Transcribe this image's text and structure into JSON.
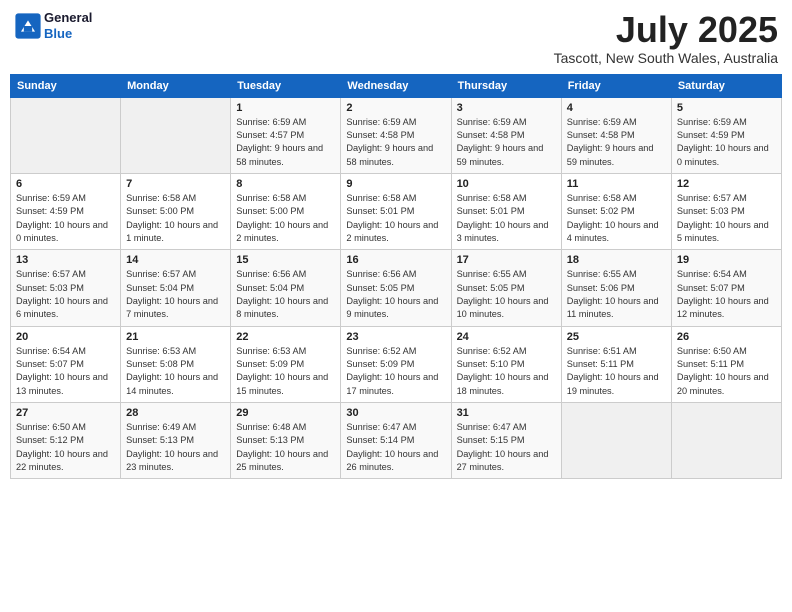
{
  "header": {
    "logo_line1": "General",
    "logo_line2": "Blue",
    "month": "July 2025",
    "location": "Tascott, New South Wales, Australia"
  },
  "columns": [
    "Sunday",
    "Monday",
    "Tuesday",
    "Wednesday",
    "Thursday",
    "Friday",
    "Saturday"
  ],
  "weeks": [
    [
      {
        "day": "",
        "detail": ""
      },
      {
        "day": "",
        "detail": ""
      },
      {
        "day": "1",
        "detail": "Sunrise: 6:59 AM\nSunset: 4:57 PM\nDaylight: 9 hours and 58 minutes."
      },
      {
        "day": "2",
        "detail": "Sunrise: 6:59 AM\nSunset: 4:58 PM\nDaylight: 9 hours and 58 minutes."
      },
      {
        "day": "3",
        "detail": "Sunrise: 6:59 AM\nSunset: 4:58 PM\nDaylight: 9 hours and 59 minutes."
      },
      {
        "day": "4",
        "detail": "Sunrise: 6:59 AM\nSunset: 4:58 PM\nDaylight: 9 hours and 59 minutes."
      },
      {
        "day": "5",
        "detail": "Sunrise: 6:59 AM\nSunset: 4:59 PM\nDaylight: 10 hours and 0 minutes."
      }
    ],
    [
      {
        "day": "6",
        "detail": "Sunrise: 6:59 AM\nSunset: 4:59 PM\nDaylight: 10 hours and 0 minutes."
      },
      {
        "day": "7",
        "detail": "Sunrise: 6:58 AM\nSunset: 5:00 PM\nDaylight: 10 hours and 1 minute."
      },
      {
        "day": "8",
        "detail": "Sunrise: 6:58 AM\nSunset: 5:00 PM\nDaylight: 10 hours and 2 minutes."
      },
      {
        "day": "9",
        "detail": "Sunrise: 6:58 AM\nSunset: 5:01 PM\nDaylight: 10 hours and 2 minutes."
      },
      {
        "day": "10",
        "detail": "Sunrise: 6:58 AM\nSunset: 5:01 PM\nDaylight: 10 hours and 3 minutes."
      },
      {
        "day": "11",
        "detail": "Sunrise: 6:58 AM\nSunset: 5:02 PM\nDaylight: 10 hours and 4 minutes."
      },
      {
        "day": "12",
        "detail": "Sunrise: 6:57 AM\nSunset: 5:03 PM\nDaylight: 10 hours and 5 minutes."
      }
    ],
    [
      {
        "day": "13",
        "detail": "Sunrise: 6:57 AM\nSunset: 5:03 PM\nDaylight: 10 hours and 6 minutes."
      },
      {
        "day": "14",
        "detail": "Sunrise: 6:57 AM\nSunset: 5:04 PM\nDaylight: 10 hours and 7 minutes."
      },
      {
        "day": "15",
        "detail": "Sunrise: 6:56 AM\nSunset: 5:04 PM\nDaylight: 10 hours and 8 minutes."
      },
      {
        "day": "16",
        "detail": "Sunrise: 6:56 AM\nSunset: 5:05 PM\nDaylight: 10 hours and 9 minutes."
      },
      {
        "day": "17",
        "detail": "Sunrise: 6:55 AM\nSunset: 5:05 PM\nDaylight: 10 hours and 10 minutes."
      },
      {
        "day": "18",
        "detail": "Sunrise: 6:55 AM\nSunset: 5:06 PM\nDaylight: 10 hours and 11 minutes."
      },
      {
        "day": "19",
        "detail": "Sunrise: 6:54 AM\nSunset: 5:07 PM\nDaylight: 10 hours and 12 minutes."
      }
    ],
    [
      {
        "day": "20",
        "detail": "Sunrise: 6:54 AM\nSunset: 5:07 PM\nDaylight: 10 hours and 13 minutes."
      },
      {
        "day": "21",
        "detail": "Sunrise: 6:53 AM\nSunset: 5:08 PM\nDaylight: 10 hours and 14 minutes."
      },
      {
        "day": "22",
        "detail": "Sunrise: 6:53 AM\nSunset: 5:09 PM\nDaylight: 10 hours and 15 minutes."
      },
      {
        "day": "23",
        "detail": "Sunrise: 6:52 AM\nSunset: 5:09 PM\nDaylight: 10 hours and 17 minutes."
      },
      {
        "day": "24",
        "detail": "Sunrise: 6:52 AM\nSunset: 5:10 PM\nDaylight: 10 hours and 18 minutes."
      },
      {
        "day": "25",
        "detail": "Sunrise: 6:51 AM\nSunset: 5:11 PM\nDaylight: 10 hours and 19 minutes."
      },
      {
        "day": "26",
        "detail": "Sunrise: 6:50 AM\nSunset: 5:11 PM\nDaylight: 10 hours and 20 minutes."
      }
    ],
    [
      {
        "day": "27",
        "detail": "Sunrise: 6:50 AM\nSunset: 5:12 PM\nDaylight: 10 hours and 22 minutes."
      },
      {
        "day": "28",
        "detail": "Sunrise: 6:49 AM\nSunset: 5:13 PM\nDaylight: 10 hours and 23 minutes."
      },
      {
        "day": "29",
        "detail": "Sunrise: 6:48 AM\nSunset: 5:13 PM\nDaylight: 10 hours and 25 minutes."
      },
      {
        "day": "30",
        "detail": "Sunrise: 6:47 AM\nSunset: 5:14 PM\nDaylight: 10 hours and 26 minutes."
      },
      {
        "day": "31",
        "detail": "Sunrise: 6:47 AM\nSunset: 5:15 PM\nDaylight: 10 hours and 27 minutes."
      },
      {
        "day": "",
        "detail": ""
      },
      {
        "day": "",
        "detail": ""
      }
    ]
  ]
}
